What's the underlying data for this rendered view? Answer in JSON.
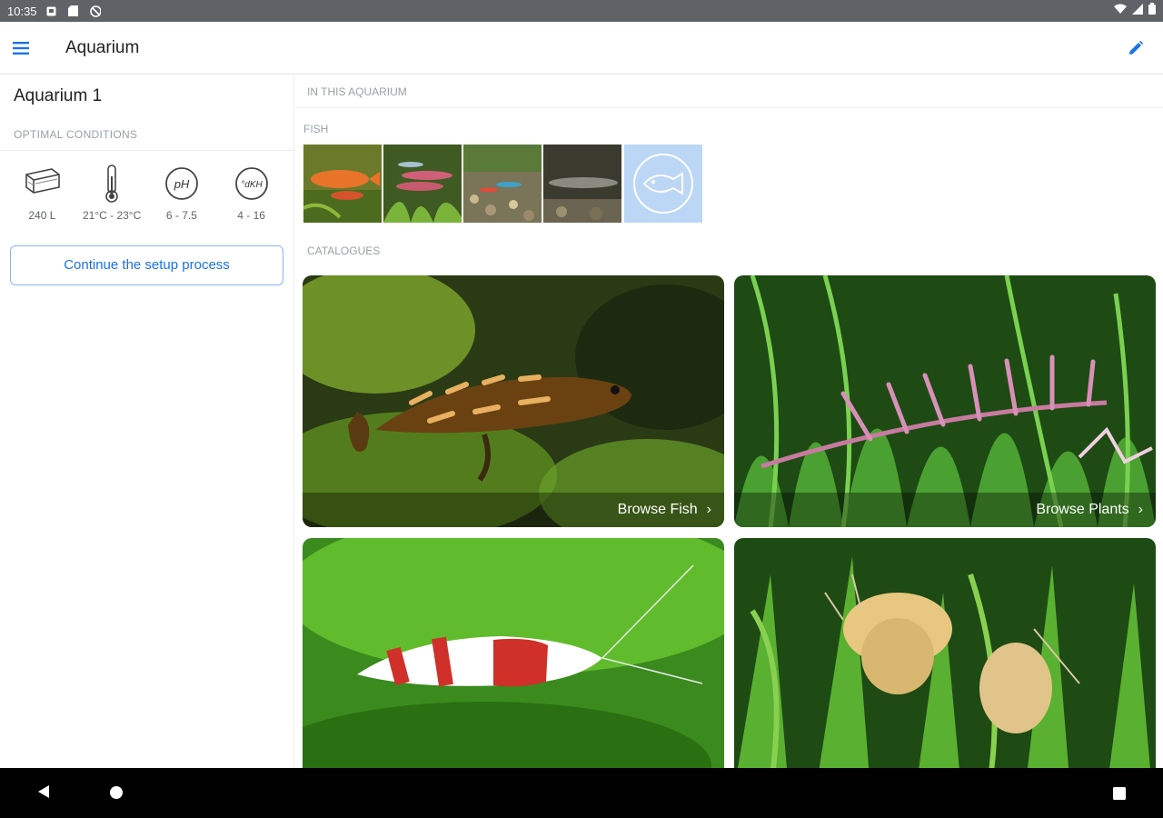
{
  "status_bar": {
    "time": "10:35"
  },
  "app_bar": {
    "title": "Aquarium"
  },
  "left_panel": {
    "aquarium_name": "Aquarium 1",
    "section_label": "OPTIMAL CONDITIONS",
    "conditions": [
      {
        "icon": "tank-volume-icon",
        "value": "240 L"
      },
      {
        "icon": "thermometer-icon",
        "value": "21°C - 23°C"
      },
      {
        "icon": "ph-icon",
        "icon_text": "pH",
        "value": "6 - 7.5"
      },
      {
        "icon": "dkh-icon",
        "icon_text": "°dKH",
        "value": "4 - 16"
      }
    ],
    "setup_button": "Continue the setup process"
  },
  "right_panel": {
    "header": "IN THIS AQUARIUM",
    "fish_label": "FISH",
    "catalogues_label": "CATALOGUES",
    "cards": [
      {
        "label": "Browse Fish",
        "image": "fish-photo"
      },
      {
        "label": "Browse Plants",
        "image": "plants-photo"
      },
      {
        "label": "",
        "image": "shrimp-photo"
      },
      {
        "label": "",
        "image": "snails-photo"
      }
    ]
  },
  "colors": {
    "accent": "#1a73e8",
    "status_bar": "#5f6368",
    "add_tile": "#bcd7f5"
  }
}
